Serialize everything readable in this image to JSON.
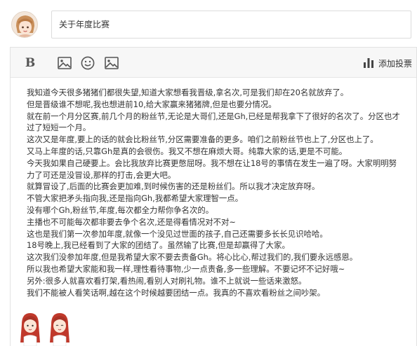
{
  "header": {
    "title_value": "关于年度比赛"
  },
  "toolbar": {
    "vote_label": "添加投票"
  },
  "content": {
    "paragraphs": [
      "我知道今天很多猪猪们都很失望,知道大家想看我晋级,拿名次,可是我们却在20名就放弃了。",
      "但是晋级谁不想呢,我也想进前10,给大家赢来猪猪牌,但是也要分情况。",
      "就在前一个月分区赛,前几个月的粉丝节,无论是大哥们,还是Gh,已经是帮我拿下了很好的名次了。分区也才过了短短一个月。",
      "这次又是年度,要上的话的就会比粉丝节,分区需要准备的更多。咱们之前粉丝节也上了,分区也上了。",
      "又马上年度的话,只靠Gh是真的会很伤。我又不想在麻烦大哥。纯靠大家的话,更是不可能。",
      "今天我如果自己硬要上。会比我放弃比赛更憋屈呀。我不想在让18号的事情在发生一遍了呀。大家明明努力了可还是没冒设,那样的打击,会更大吧。",
      "就算冒设了,后面的比赛会更加难,到时候伤害的还是粉丝们。所以我才决定放弃呀。",
      "不管大家把矛头指向我,还是指向Gh,我都希望大家理智一点。",
      "没有哪个Gh,粉丝节,年度,每次都全力帮你争名次的。",
      "主播也不可能每次都非要去争个名次,还是得看情况对不对~",
      "这也是我们第一次参加年度,就像一个没见过世面的孩子,自己还需要多长长见识哈哈。",
      "18号晚上,我已经看到了大家的团结了。虽然输了比赛,但是却赢得了大家。",
      "这次我们没参加年度,但是我希望大家不要去责备Gh。将心比心,帮过我们的,我们要永远感恩。",
      "所以我也希望大家能和我一样,理性看待事物,少一点责备,多一些理解。不要记坏不记好哦~",
      "另外:很多人就喜欢看打架,看热闹,看别人对刷礼物。谁不上就说一些话来激怒。",
      "我们不能被人看笑话啊,越在这个时候越要团结一点。我真的不喜欢看粉丝之间吵架。"
    ]
  },
  "icons": {
    "bold": "bold-icon",
    "emoji": "emoji-icon",
    "image": "image-icon",
    "vote": "bar-chart-icon"
  }
}
